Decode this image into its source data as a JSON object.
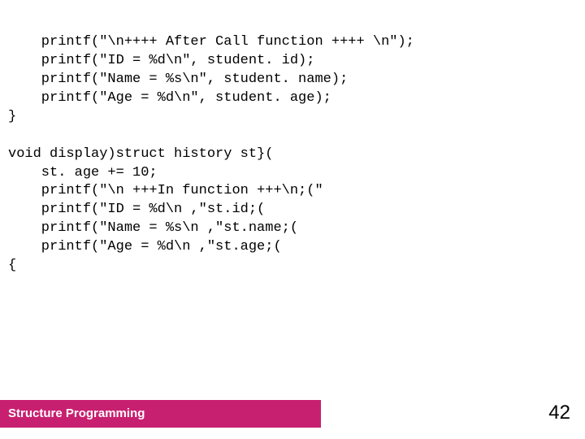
{
  "code": {
    "lines": [
      "    printf(\"\\n++++ After Call function ++++ \\n\");",
      "    printf(\"ID = %d\\n\", student. id);",
      "    printf(\"Name = %s\\n\", student. name);",
      "    printf(\"Age = %d\\n\", student. age);",
      "}",
      "",
      "void display)struct history st}(",
      "    st. age += 10;",
      "    printf(\"\\n +++In function +++\\n;(\"",
      "    printf(\"ID = %d\\n ,\"st.id;(",
      "    printf(\"Name = %s\\n ,\"st.name;(",
      "    printf(\"Age = %d\\n ,\"st.age;(",
      "{"
    ]
  },
  "footer": {
    "label": "Structure Programming",
    "page": "42"
  }
}
